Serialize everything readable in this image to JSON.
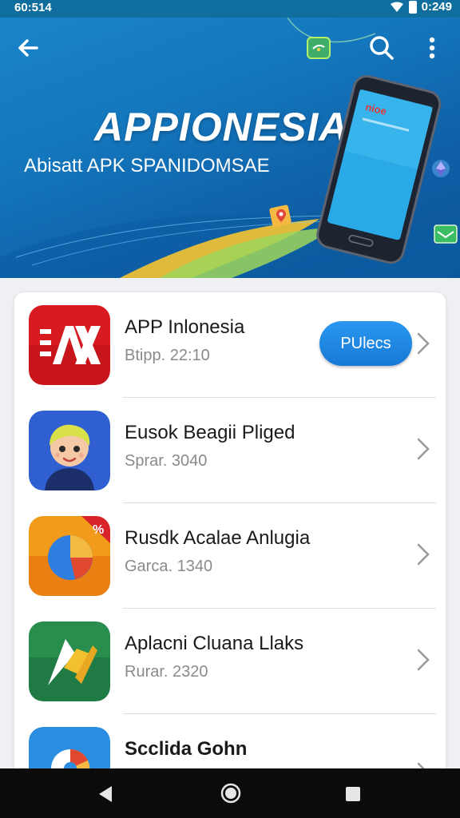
{
  "status_bar": {
    "time": "60:514",
    "clock_right": "0:249"
  },
  "hero": {
    "title": "APPIONESIA",
    "subtitle": "Abisatt APK SPANIDOMSAE",
    "phone_screen_text": "nioe"
  },
  "colors": {
    "accent": "#1679d6",
    "hero_blue": "#1477bd",
    "nav_bar": "#0b0b0b"
  },
  "icons": {
    "back": "arrow-left-icon",
    "cast": "cast-icon",
    "search": "search-icon",
    "more": "more-vertical-icon",
    "chevron": "chevron-right-icon"
  },
  "apps": [
    {
      "name": "APP Inlonesia",
      "meta": "Btipp. 22:10",
      "icon": "red-ax-app-icon",
      "button_label": "PUlecs"
    },
    {
      "name": "Eusok Beagii Pliged",
      "meta": "Sprar. 3040",
      "icon": "cartoon-avatar-app-icon"
    },
    {
      "name": "Rusdk Acalae Anlugia",
      "meta": "Garca. 1340",
      "icon": "orange-pie-app-icon"
    },
    {
      "name": "Aplacni Cluana Llaks",
      "meta": "Rurar. 2320",
      "icon": "green-shape-app-icon"
    },
    {
      "name": "Scclida Gohn",
      "meta": "",
      "icon": "blue-chrome-app-icon"
    }
  ]
}
